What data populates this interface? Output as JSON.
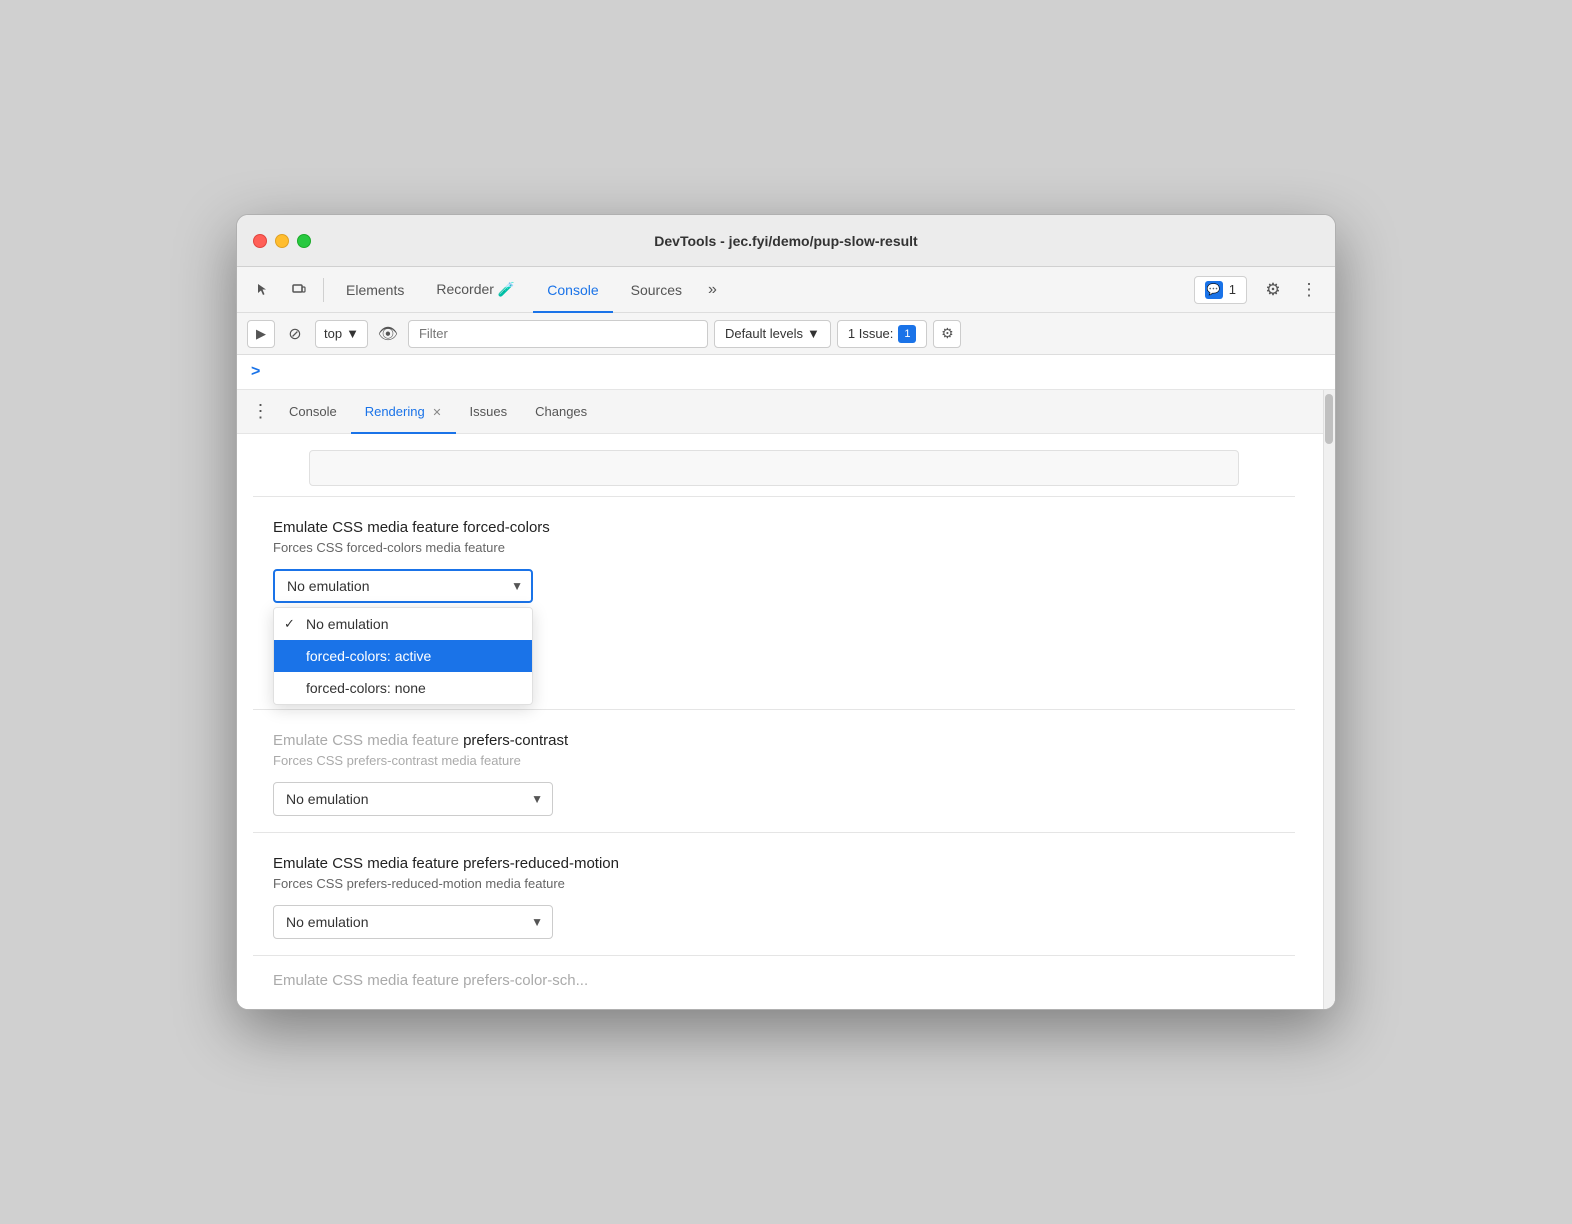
{
  "window": {
    "title": "DevTools - jec.fyi/demo/pup-slow-result"
  },
  "traffic_lights": {
    "close_label": "close",
    "minimize_label": "minimize",
    "maximize_label": "maximize"
  },
  "toolbar": {
    "tabs": [
      {
        "id": "elements",
        "label": "Elements",
        "active": false
      },
      {
        "id": "recorder",
        "label": "Recorder 🧪",
        "active": false
      },
      {
        "id": "console",
        "label": "Console",
        "active": true
      },
      {
        "id": "sources",
        "label": "Sources",
        "active": false
      }
    ],
    "more_tabs_label": "»",
    "badge_count": "1",
    "gear_icon": "⚙",
    "more_icon": "⋮",
    "inspect_icon": "⬚",
    "device_icon": "⬱"
  },
  "console_toolbar": {
    "play_icon": "▶",
    "ban_icon": "⊘",
    "top_label": "top",
    "dropdown_arrow": "▼",
    "eye_icon": "👁",
    "filter_placeholder": "Filter",
    "levels_label": "Default levels",
    "levels_arrow": "▼",
    "issue_label": "1 Issue:",
    "issue_count": "1",
    "gear_icon": "⚙"
  },
  "console_prompt": {
    "chevron": ">"
  },
  "bottom_panel": {
    "tabs": [
      {
        "id": "console",
        "label": "Console",
        "closeable": false,
        "active": false
      },
      {
        "id": "rendering",
        "label": "Rendering",
        "closeable": true,
        "active": true
      },
      {
        "id": "issues",
        "label": "Issues",
        "closeable": false,
        "active": false
      },
      {
        "id": "changes",
        "label": "Changes",
        "closeable": false,
        "active": false
      }
    ],
    "close_icon": "✕"
  },
  "rendering": {
    "top_placeholder_visible": true,
    "sections": [
      {
        "id": "forced-colors",
        "title": "Emulate CSS media feature forced-colors",
        "description": "Forces CSS forced-colors media feature",
        "dropdown": {
          "current_value": "No emulation",
          "options": [
            {
              "label": "No emulation",
              "checked": true,
              "selected": false
            },
            {
              "label": "forced-colors: active",
              "checked": false,
              "selected": true
            },
            {
              "label": "forced-colors: none",
              "checked": false,
              "selected": false
            }
          ],
          "is_open": true
        }
      },
      {
        "id": "prefers-contrast",
        "title": "Emulate CSS media feature prefers-contrast",
        "description": "Forces CSS prefers-contrast media feature",
        "dropdown": {
          "current_value": "No emulation",
          "options": [],
          "is_open": false
        }
      },
      {
        "id": "prefers-reduced-motion",
        "title": "Emulate CSS media feature prefers-reduced-motion",
        "description": "Forces CSS prefers-reduced-motion media feature",
        "dropdown": {
          "current_value": "No emulation",
          "options": [],
          "is_open": false
        }
      },
      {
        "id": "bottom-truncated",
        "title": "Emulate CSS media feature prefers-color-scheme",
        "description": "",
        "dropdown": null
      }
    ]
  },
  "scrollbar": {
    "visible": true
  },
  "colors": {
    "accent_blue": "#1a73e8",
    "selected_bg": "#1a73e8",
    "tab_underline": "#1a73e8",
    "window_bg": "#f5f5f5",
    "border": "#d0d0d0"
  }
}
